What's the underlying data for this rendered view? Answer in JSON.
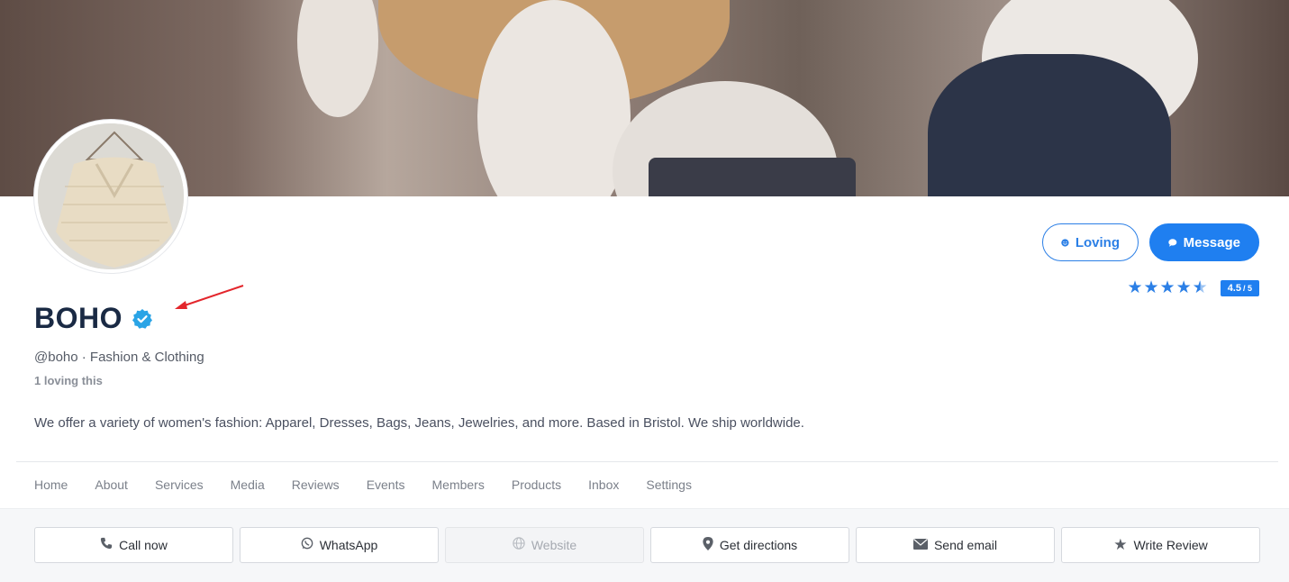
{
  "profile": {
    "name": "BOHO",
    "handle_line": "@boho · Fashion & Clothing",
    "loving_count": "1 loving this",
    "about": "We offer a variety of women's fashion: Apparel, Dresses, Bags, Jeans, Jewelries, and more. Based in Bristol. We ship worldwide."
  },
  "actions": {
    "loving_label": "Loving",
    "message_label": "Message"
  },
  "rating": {
    "value": 4.5,
    "max": 5,
    "badge_value": "4.5",
    "badge_max": "/ 5"
  },
  "nav": {
    "items": [
      "Home",
      "About",
      "Services",
      "Media",
      "Reviews",
      "Events",
      "Members",
      "Products",
      "Inbox",
      "Settings"
    ]
  },
  "quick_actions": [
    {
      "label": "Call now",
      "icon": "phone-icon"
    },
    {
      "label": "WhatsApp",
      "icon": "whatsapp-icon"
    },
    {
      "label": "Website",
      "icon": "globe-icon"
    },
    {
      "label": "Get directions",
      "icon": "map-pin-icon"
    },
    {
      "label": "Send email",
      "icon": "envelope-icon"
    },
    {
      "label": "Write Review",
      "icon": "star-icon"
    }
  ],
  "colors": {
    "accent": "#1f7ff0",
    "name_text": "#1a2a44",
    "verified": "#2aa4e6",
    "annotation_arrow": "#e3262c"
  }
}
